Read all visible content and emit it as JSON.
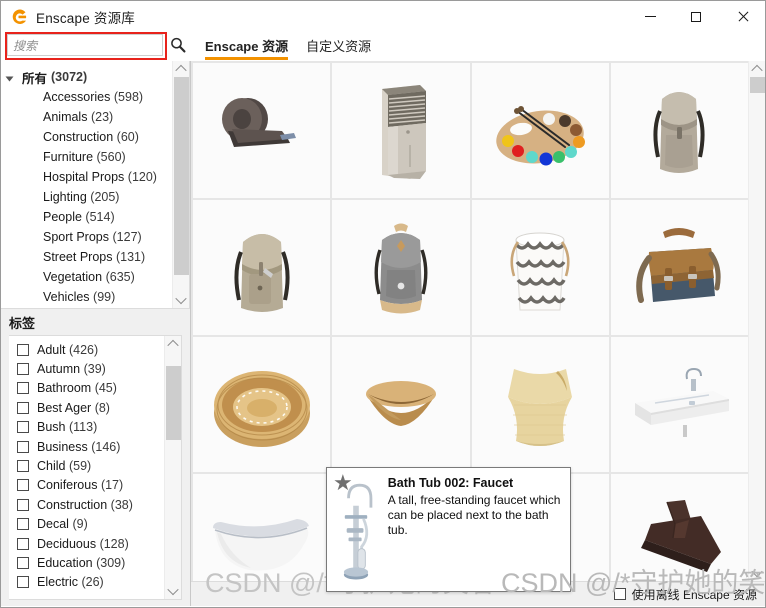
{
  "window": {
    "title": "Enscape 资源库",
    "logo_icon": "enscape-logo-icon",
    "minimize_label": "—",
    "maximize_label": "□",
    "close_label": "✕"
  },
  "search": {
    "placeholder": "搜索",
    "value": "",
    "icon": "search-icon",
    "highlight_color": "#e8231c"
  },
  "tabs": [
    {
      "label": "Enscape 资源",
      "active": true
    },
    {
      "label": "自定义资源",
      "active": false
    }
  ],
  "accent_color": "#f39200",
  "categories": {
    "root": {
      "label": "所有",
      "count": "(3072)"
    },
    "items": [
      {
        "label": "Accessories",
        "count": "(598)"
      },
      {
        "label": "Animals",
        "count": "(23)"
      },
      {
        "label": "Construction",
        "count": "(60)"
      },
      {
        "label": "Furniture",
        "count": "(560)"
      },
      {
        "label": "Hospital Props",
        "count": "(120)"
      },
      {
        "label": "Lighting",
        "count": "(205)"
      },
      {
        "label": "People",
        "count": "(514)"
      },
      {
        "label": "Sport Props",
        "count": "(127)"
      },
      {
        "label": "Street Props",
        "count": "(131)"
      },
      {
        "label": "Vegetation",
        "count": "(635)"
      },
      {
        "label": "Vehicles",
        "count": "(99)"
      }
    ]
  },
  "tags": {
    "title": "标签",
    "items": [
      {
        "label": "Adult",
        "count": "(426)",
        "checked": false
      },
      {
        "label": "Autumn",
        "count": "(39)",
        "checked": false
      },
      {
        "label": "Bathroom",
        "count": "(45)",
        "checked": false
      },
      {
        "label": "Best Ager",
        "count": "(8)",
        "checked": false
      },
      {
        "label": "Bush",
        "count": "(113)",
        "checked": false
      },
      {
        "label": "Business",
        "count": "(146)",
        "checked": false
      },
      {
        "label": "Child",
        "count": "(59)",
        "checked": false
      },
      {
        "label": "Coniferous",
        "count": "(17)",
        "checked": false
      },
      {
        "label": "Construction",
        "count": "(38)",
        "checked": false
      },
      {
        "label": "Decal",
        "count": "(9)",
        "checked": false
      },
      {
        "label": "Deciduous",
        "count": "(128)",
        "checked": false
      },
      {
        "label": "Education",
        "count": "(309)",
        "checked": false
      },
      {
        "label": "Electric",
        "count": "(26)",
        "checked": false
      }
    ]
  },
  "assets": [
    {
      "name": "tape-dispenser",
      "alt": "Tape dispenser"
    },
    {
      "name": "air-cooler",
      "alt": "Air cooler"
    },
    {
      "name": "paint-palette",
      "alt": "Paint palette"
    },
    {
      "name": "backpack-gray",
      "alt": "Gray backpack"
    },
    {
      "name": "backpack-beige",
      "alt": "Beige backpack"
    },
    {
      "name": "backpack-charcoal",
      "alt": "Charcoal backpack"
    },
    {
      "name": "laundry-basket",
      "alt": "Striped laundry basket"
    },
    {
      "name": "satchel-bag",
      "alt": "Leather satchel bag"
    },
    {
      "name": "wicker-basket",
      "alt": "Wicker basket"
    },
    {
      "name": "wooden-bowl",
      "alt": "Wooden bowl"
    },
    {
      "name": "fabric-basket",
      "alt": "Fabric storage basket"
    },
    {
      "name": "wash-basin",
      "alt": "White wash basin"
    },
    {
      "name": "bath-tub",
      "alt": "Free-standing bath tub"
    },
    {
      "name": "bath-faucet",
      "alt": "Free-standing bath faucet"
    },
    {
      "name": "floor-squeegee",
      "alt": "Dark floor squeegee"
    }
  ],
  "tooltip": {
    "title": "Bath Tub 002: Faucet",
    "description": "A tall, free-standing faucet which can be placed next to the bath tub.",
    "favorite_icon": "star-icon",
    "preview_icon": "bath-faucet-preview"
  },
  "footer": {
    "offline_label": "使用离线 Enscape 资源",
    "offline_checked": false
  },
  "watermark": {
    "text": "CSDN @/*守护她的笑容"
  }
}
